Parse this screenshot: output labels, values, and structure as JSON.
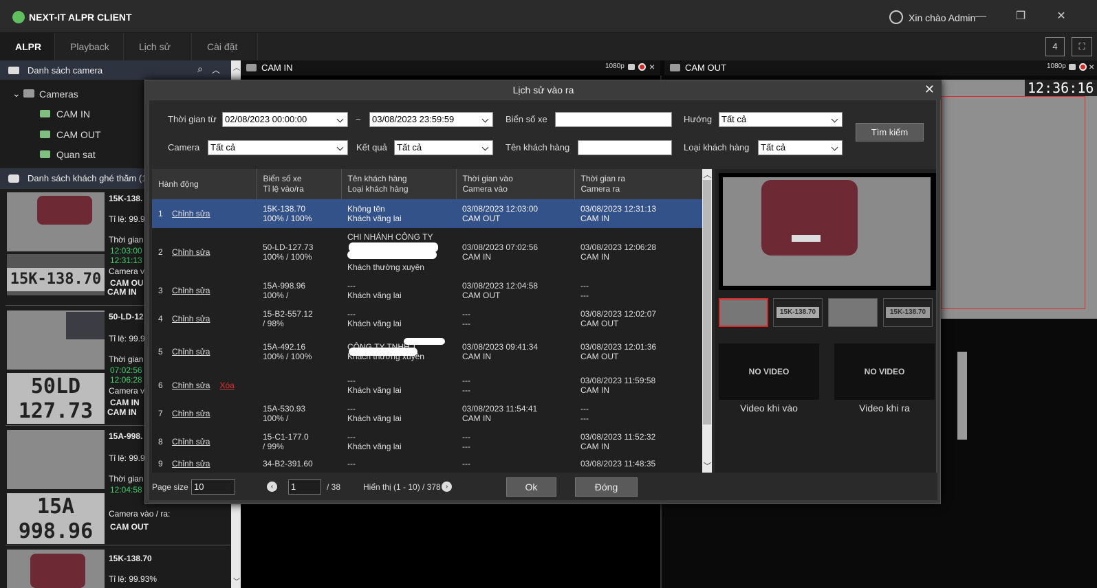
{
  "app": {
    "title": "NEXT-IT ALPR CLIENT",
    "greeting": "Xin chào Admin"
  },
  "window": {
    "minimize": "—",
    "restore": "❐",
    "close": "✕"
  },
  "tabs": [
    "ALPR",
    "Playback",
    "Lịch sử",
    "Cài đặt"
  ],
  "top_right": {
    "layout": "4",
    "fullscreen": "⛶"
  },
  "sidebar": {
    "camera_list": "Danh sách camera",
    "root": "Cameras",
    "cameras": [
      "CAM IN",
      "CAM OUT",
      "Quan sat"
    ],
    "visitors_title": "Danh sách khách ghé thăm (1:"
  },
  "visitors": [
    {
      "plate": "15K-138.",
      "rate": "Tỉ lệ: 99.9",
      "time_label": "Thời gian",
      "t1": "12:03:00",
      "t2": "12:31:13",
      "cam_label": "Camera v",
      "c1": "CAM OU",
      "c2": "CAM IN",
      "plate_img": "15K-138.70"
    },
    {
      "plate": "50-LD-12",
      "rate": "Tỉ lệ: 99.9",
      "time_label": "Thời gian",
      "t1": "07:02:56",
      "t2": "12:06:28",
      "cam_label": "Camera v",
      "c1": "CAM IN",
      "c2": "CAM IN",
      "plate_img1": "50LD",
      "plate_img2": "127.73"
    },
    {
      "plate": "15A-998.",
      "rate": "Tỉ lệ: 99.9",
      "time_label": "Thời gian",
      "t1": "12:04:58",
      "cam_label": "Camera vào / ra:",
      "c1": "CAM OUT",
      "plate_img1": "15A",
      "plate_img2": "998.96"
    },
    {
      "plate": "15K-138.70",
      "rate": "Tỉ lệ: 99.93%"
    }
  ],
  "cams": [
    {
      "title": "CAM IN",
      "res": "1080p"
    },
    {
      "title": "CAM OUT",
      "res": "1080p",
      "clock": "12:36:16"
    }
  ],
  "dialog": {
    "title": "Lịch sử vào ra",
    "filters": {
      "from_label": "Thời gian từ",
      "from": "02/08/2023 00:00:00",
      "tilde": "~",
      "to": "03/08/2023 23:59:59",
      "plate_label": "Biển số xe",
      "dir_label": "Hướng",
      "dir": "Tất cả",
      "camera_label": "Camera",
      "camera": "Tất cả",
      "result_label": "Kết quả",
      "result": "Tất cả",
      "name_label": "Tên khách hàng",
      "type_label": "Loại khách hàng",
      "type": "Tất cả",
      "search": "Tìm kiếm"
    },
    "columns": [
      [
        "Hành động",
        ""
      ],
      [
        "Biển số xe",
        "Tỉ lệ vào/ra"
      ],
      [
        "Tên khách hàng",
        "Loại khách hàng"
      ],
      [
        "Thời gian vào",
        "Camera vào"
      ],
      [
        "Thời gian ra",
        "Camera ra"
      ]
    ],
    "rows": [
      {
        "no": "1",
        "edit": "Chỉnh sửa",
        "del": "",
        "plate": "15K-138.70",
        "rate": "100% / 100%",
        "name": "Không tên",
        "type": "Khách vãng lai",
        "tin": "03/08/2023 12:03:00",
        "cin": "CAM OUT",
        "tout": "03/08/2023 12:31:13",
        "cout": "CAM IN"
      },
      {
        "no": "2",
        "edit": "Chỉnh sửa",
        "del": "",
        "plate": "50-LD-127.73",
        "rate": "100% / 100%",
        "name": "CHI NHÁNH CÔNG TY",
        "type": "Khách thường xuyên",
        "tin": "03/08/2023 07:02:56",
        "cin": "CAM IN",
        "tout": "03/08/2023 12:06:28",
        "cout": "CAM IN"
      },
      {
        "no": "3",
        "edit": "Chỉnh sửa",
        "del": "",
        "plate": "15A-998.96",
        "rate": "100% /",
        "name": "---",
        "type": "Khách vãng lai",
        "tin": "03/08/2023 12:04:58",
        "cin": "CAM OUT",
        "tout": "---",
        "cout": "---"
      },
      {
        "no": "4",
        "edit": "Chỉnh sửa",
        "del": "",
        "plate": "15-B2-557.12",
        "rate": " / 98%",
        "name": "---",
        "type": "Khách vãng lai",
        "tin": "---",
        "cin": "---",
        "tout": "03/08/2023 12:02:07",
        "cout": "CAM OUT"
      },
      {
        "no": "5",
        "edit": "Chỉnh sửa",
        "del": "",
        "plate": "15A-492.16",
        "rate": "100% / 100%",
        "name": "CÔNG TY TNHH T",
        "type": "Khách thường xuyên",
        "tin": "03/08/2023 09:41:34",
        "cin": "CAM IN",
        "tout": "03/08/2023 12:01:36",
        "cout": "CAM OUT"
      },
      {
        "no": "6",
        "edit": "Chỉnh sửa",
        "del": "Xóa",
        "plate": "",
        "rate": "",
        "name": "---",
        "type": "Khách vãng lai",
        "tin": "---",
        "cin": "---",
        "tout": "03/08/2023 11:59:58",
        "cout": "CAM IN"
      },
      {
        "no": "7",
        "edit": "Chỉnh sửa",
        "del": "",
        "plate": "15A-530.93",
        "rate": "100% /",
        "name": "---",
        "type": "Khách vãng lai",
        "tin": "03/08/2023 11:54:41",
        "cin": "CAM IN",
        "tout": "---",
        "cout": "---"
      },
      {
        "no": "8",
        "edit": "Chỉnh sửa",
        "del": "",
        "plate": "15-C1-177.0",
        "rate": " / 99%",
        "name": "---",
        "type": "Khách vãng lai",
        "tin": "---",
        "cin": "---",
        "tout": "03/08/2023 11:52:32",
        "cout": "CAM IN"
      },
      {
        "no": "9",
        "edit": "Chỉnh sửa",
        "del": "",
        "plate": "34-B2-391.60",
        "rate": "",
        "name": "---",
        "type": "",
        "tin": "---",
        "cin": "",
        "tout": "03/08/2023 11:48:35",
        "cout": ""
      }
    ],
    "preview": {
      "plate_thumb": "15K-138.70",
      "no_video": "NO VIDEO",
      "video_in": "Video khi vào",
      "video_out": "Video khi ra"
    },
    "pager": {
      "size_label": "Page size",
      "size": "10",
      "page": "1",
      "total": "/ 38",
      "display": "Hiển thị (1 - 10) / 378"
    },
    "ok": "Ok",
    "close": "Đóng"
  }
}
